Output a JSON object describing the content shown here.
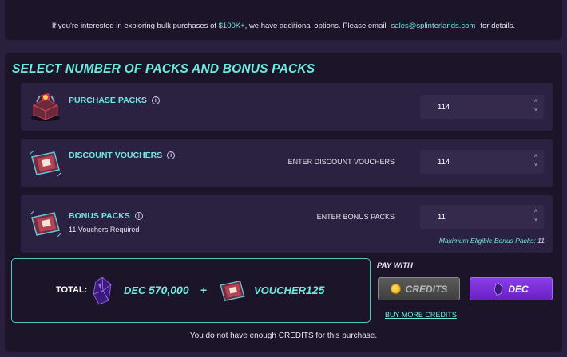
{
  "banner": {
    "text_before": "If you're interested in exploring bulk purchases of",
    "highlight": "$100K+",
    "text_middle": ", we have additional options. Please email",
    "email": "sales@splinterlands.com",
    "text_after": "for details."
  },
  "section_title": "SELECT NUMBER OF PACKS AND BONUS PACKS",
  "rows": {
    "purchase_packs": {
      "label": "PURCHASE PACKS",
      "value": "114",
      "icon": "pack-chest-icon"
    },
    "discount_vouchers": {
      "label": "DISCOUNT VOUCHERS",
      "enter_label": "ENTER DISCOUNT VOUCHERS",
      "value": "114",
      "icon": "voucher-icon"
    },
    "bonus_packs": {
      "label": "BONUS PACKS",
      "sub": "11 Vouchers Required",
      "enter_label": "ENTER BONUS PACKS",
      "value": "11",
      "max_eligible_label": "Maximum Eligible Bonus Packs:",
      "max_eligible_value": "11",
      "icon": "voucher-icon"
    }
  },
  "total": {
    "label": "TOTAL:",
    "dec_currency": "DEC",
    "dec_value": "570,000",
    "plus": "+",
    "voucher_currency": "VOUCHER",
    "voucher_value": "125"
  },
  "pay": {
    "label": "PAY WITH",
    "credits_label": "CREDITS",
    "dec_label": "DEC",
    "buy_more": "BUY MORE CREDITS"
  },
  "warning": "You do not have enough CREDITS for this purchase.",
  "colors": {
    "accent": "#6ee9e0",
    "panel": "#1c1428",
    "row": "#2b2140",
    "dec_button": "#7b2fd9"
  }
}
